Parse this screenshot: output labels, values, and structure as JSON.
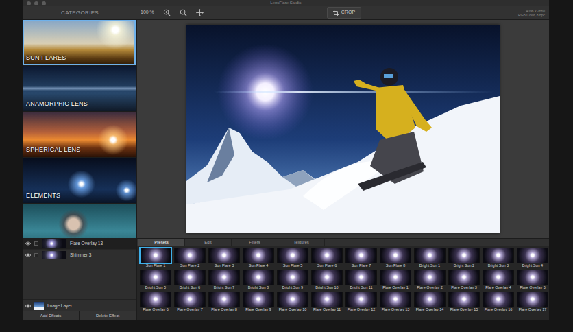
{
  "window": {
    "title": "LensFlare Studio"
  },
  "toolbar": {
    "categories_label": "CATEGORIES",
    "zoom": "100 %",
    "crop": "CROP",
    "image_info": [
      "4096 x 2660",
      "RGB Color, 8 bpc"
    ]
  },
  "categories": [
    {
      "label": "SUN FLARES",
      "selected": true
    },
    {
      "label": "ANAMORPHIC LENS",
      "selected": false
    },
    {
      "label": "SPHERICAL LENS",
      "selected": false
    },
    {
      "label": "ELEMENTS",
      "selected": false
    },
    {
      "selected": false
    }
  ],
  "layers": [
    {
      "name": "Flare Overlay 13",
      "selected": true,
      "visible": true
    },
    {
      "name": "Shimmer 3",
      "selected": false,
      "visible": true
    }
  ],
  "image_layer": {
    "name": "Image Layer",
    "visible": true
  },
  "layer_buttons": [
    "Add Effects",
    "Delete Effect"
  ],
  "tabs": [
    {
      "label": "Presets",
      "selected": true
    },
    {
      "label": "Edit",
      "selected": false
    },
    {
      "label": "Filters",
      "selected": false
    },
    {
      "label": "Textures",
      "selected": false
    }
  ],
  "presets": [
    {
      "label": "Sun Flare 1",
      "selected": true
    },
    {
      "label": "Sun Flare 2",
      "selected": false
    },
    {
      "label": "Sun Flare 3",
      "selected": false
    },
    {
      "label": "Sun Flare 4",
      "selected": false
    },
    {
      "label": "Sun Flare 5",
      "selected": false
    },
    {
      "label": "Sun Flare 6",
      "selected": false
    },
    {
      "label": "Sun Flare 7",
      "selected": false
    },
    {
      "label": "Sun Flare 8",
      "selected": false
    },
    {
      "label": "Bright Sun 1",
      "selected": false
    },
    {
      "label": "Bright Sun 2",
      "selected": false
    },
    {
      "label": "Bright Sun 3",
      "selected": false
    },
    {
      "label": "Bright Sun 4",
      "selected": false
    },
    {
      "label": "Bright Sun 5",
      "selected": false
    },
    {
      "label": "Bright Sun 6",
      "selected": false
    },
    {
      "label": "Bright Sun 7",
      "selected": false
    },
    {
      "label": "Bright Sun 8",
      "selected": false
    },
    {
      "label": "Bright Sun 9",
      "selected": false
    },
    {
      "label": "Bright Sun 10",
      "selected": false
    },
    {
      "label": "Bright Sun 11",
      "selected": false
    },
    {
      "label": "Flare Overlay 1",
      "selected": false
    },
    {
      "label": "Flare Overlay 2",
      "selected": false
    },
    {
      "label": "Flare Overlay 3",
      "selected": false
    },
    {
      "label": "Flare Overlay 4",
      "selected": false
    },
    {
      "label": "Flare Overlay 5",
      "selected": false
    },
    {
      "label": "Flare Overlay 6",
      "selected": false
    },
    {
      "label": "Flare Overlay 7",
      "selected": false
    },
    {
      "label": "Flare Overlay 8",
      "selected": false
    },
    {
      "label": "Flare Overlay 9",
      "selected": false
    },
    {
      "label": "Flare Overlay 10",
      "selected": false
    },
    {
      "label": "Flare Overlay 11",
      "selected": false
    },
    {
      "label": "Flare Overlay 12",
      "selected": false
    },
    {
      "label": "Flare Overlay 13",
      "selected": false
    },
    {
      "label": "Flare Overlay 14",
      "selected": false
    },
    {
      "label": "Flare Overlay 15",
      "selected": false
    },
    {
      "label": "Flare Overlay 16",
      "selected": false
    },
    {
      "label": "Flare Overlay 17",
      "selected": false
    }
  ]
}
